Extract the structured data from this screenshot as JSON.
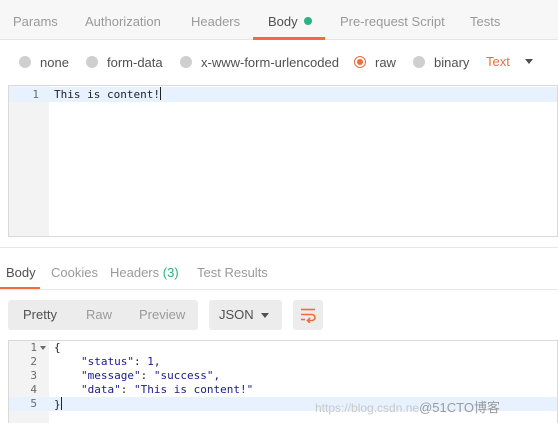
{
  "request_tabs": [
    {
      "label": "Params"
    },
    {
      "label": "Authorization"
    },
    {
      "label": "Headers"
    },
    {
      "label": "Body"
    },
    {
      "label": "Pre-request Script"
    },
    {
      "label": "Tests"
    }
  ],
  "body_types": [
    {
      "label": "none",
      "selected": false
    },
    {
      "label": "form-data",
      "selected": false
    },
    {
      "label": "x-www-form-urlencoded",
      "selected": false
    },
    {
      "label": "raw",
      "selected": true
    },
    {
      "label": "binary",
      "selected": false
    }
  ],
  "raw_format": "Text",
  "request_editor": {
    "line_numbers": [
      "1"
    ],
    "lines": [
      "This is content!"
    ]
  },
  "response_tabs": [
    {
      "label": "Body"
    },
    {
      "label": "Cookies"
    },
    {
      "label": "Headers",
      "count": "(3)"
    },
    {
      "label": "Test Results"
    }
  ],
  "view_modes": [
    {
      "label": "Pretty"
    },
    {
      "label": "Raw"
    },
    {
      "label": "Preview"
    }
  ],
  "response_format": "JSON",
  "response_editor": {
    "line_numbers": [
      "1",
      "2",
      "3",
      "4",
      "5"
    ],
    "open_brace": "{",
    "close_brace": "}",
    "fields": [
      {
        "key": "\"status\"",
        "value": "1,"
      },
      {
        "key": "\"message\"",
        "value": "\"success\","
      },
      {
        "key": "\"data\"",
        "value": "\"This is content!\""
      }
    ]
  },
  "watermark": {
    "url": "https://blog.csdn.ne",
    "brand": "@51CTO博客"
  },
  "colors": {
    "accent": "#f26b3a",
    "dot_green": "#26b47f"
  },
  "icons": {
    "wrap": "wrap-lines-icon",
    "caret": "chevron-down-icon",
    "fold": "fold-caret-icon"
  }
}
